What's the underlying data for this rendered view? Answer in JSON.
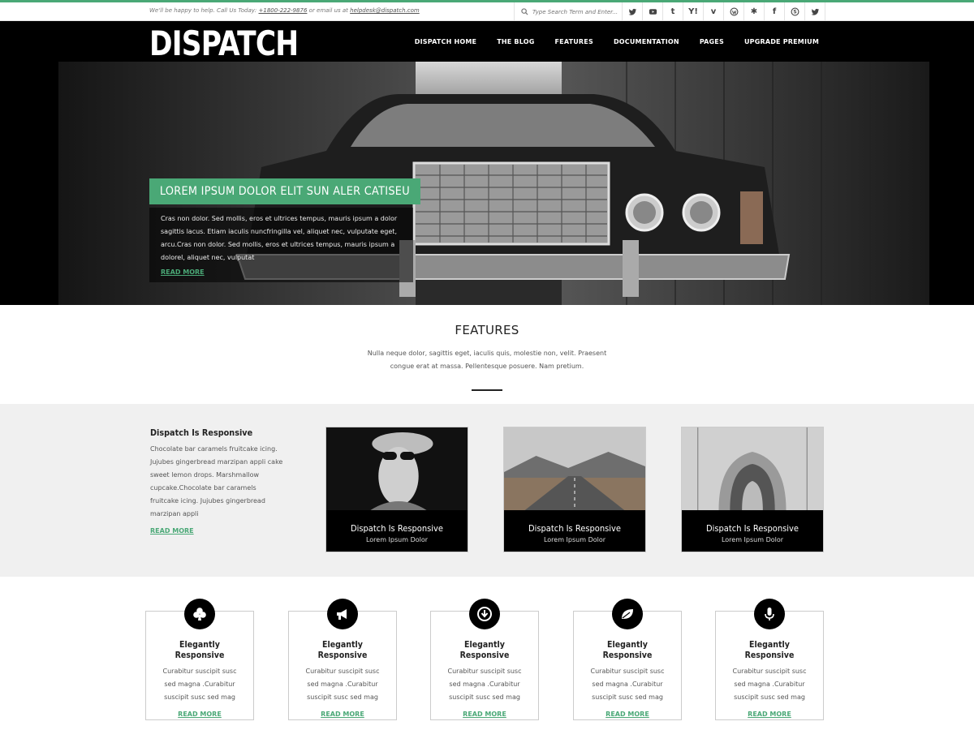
{
  "topbar": {
    "contact_prefix": "We'll be happy to help. Call Us Today:",
    "phone": "+1800-222-9876",
    "contact_mid": "or email us at",
    "email": "helpdesk@dispatch.com",
    "search_placeholder": "Type Search Term and Enter...",
    "social": [
      "twitter-icon",
      "youtube-icon",
      "tumblr-icon",
      "yahoo-icon",
      "vimeo-icon",
      "wordpress-icon",
      "yelp-icon",
      "facebook-icon",
      "skype-icon",
      "twitter-icon"
    ]
  },
  "header": {
    "logo": "DISPATCH",
    "nav": [
      "DISPATCH HOME",
      "THE BLOG",
      "FEATURES",
      "DOCUMENTATION",
      "PAGES",
      "UPGRADE PREMIUM"
    ]
  },
  "hero": {
    "title": "LOREM IPSUM DOLOR ELIT SUN ALER CATISEU",
    "text": "Cras non dolor. Sed mollis, eros et ultrices tempus, mauris ipsum a dolor sagittis lacus. Etiam iaculis nuncfringilla vel, aliquet nec, vulputate eget, arcu.Cras non dolor. Sed mollis, eros et ultrices tempus, mauris ipsum a dolorel, aliquet nec, vulputat",
    "read_more": "READ MORE"
  },
  "features": {
    "heading": "FEATURES",
    "text": "Nulla neque dolor, sagittis eget, iaculis quis, molestie non, velit. Praesent congue erat at massa. Pellentesque posuere. Nam pretium."
  },
  "intro": {
    "title": "Dispatch Is Responsive",
    "text": "Chocolate bar caramels fruitcake icing. Jujubes gingerbread marzipan appli cake sweet lemon drops. Marshmallow cupcake.Chocolate bar caramels fruitcake icing. Jujubes gingerbread marzipan appli",
    "read_more": "READ MORE"
  },
  "cards": [
    {
      "title": "Dispatch Is Responsive",
      "subtitle": "Lorem Ipsum Dolor"
    },
    {
      "title": "Dispatch Is Responsive",
      "subtitle": "Lorem Ipsum Dolor"
    },
    {
      "title": "Dispatch Is Responsive",
      "subtitle": "Lorem Ipsum Dolor"
    }
  ],
  "boxes": [
    {
      "icon": "club-icon",
      "title": "Elegantly Responsive",
      "text": "Curabitur suscipit susc sed magna .Curabitur suscipit susc sed mag",
      "read_more": "READ MORE"
    },
    {
      "icon": "megaphone-icon",
      "title": "Elegantly Responsive",
      "text": "Curabitur suscipit susc sed magna .Curabitur suscipit susc sed mag",
      "read_more": "READ MORE"
    },
    {
      "icon": "download-icon",
      "title": "Elegantly Responsive",
      "text": "Curabitur suscipit susc sed magna .Curabitur suscipit susc sed mag",
      "read_more": "READ MORE"
    },
    {
      "icon": "leaf-icon",
      "title": "Elegantly Responsive",
      "text": "Curabitur suscipit susc sed magna .Curabitur suscipit susc sed mag",
      "read_more": "READ MORE"
    },
    {
      "icon": "microphone-icon",
      "title": "Elegantly Responsive",
      "text": "Curabitur suscipit susc sed magna .Curabitur suscipit susc sed mag",
      "read_more": "READ MORE"
    }
  ],
  "colors": {
    "accent": "#4aa876",
    "dark": "#000000",
    "grey_bg": "#f0f0f0"
  }
}
